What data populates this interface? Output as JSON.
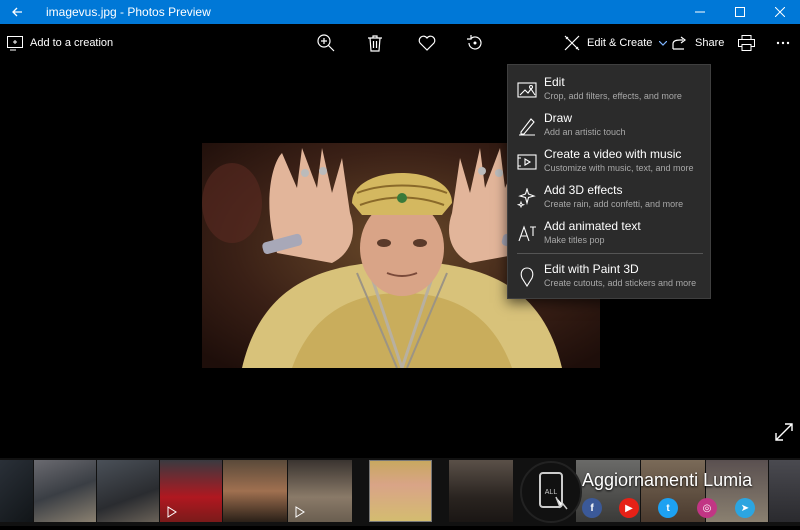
{
  "window": {
    "title": "imagevus.jpg - Photos Preview",
    "controls": [
      "minimize",
      "maximize",
      "close"
    ]
  },
  "toolbar": {
    "add_to_creation": "Add to a creation",
    "edit_create": "Edit & Create",
    "share": "Share",
    "icons": [
      "zoom-icon",
      "delete-icon",
      "favorite-icon",
      "rotate-icon",
      "print-icon",
      "more-icon"
    ]
  },
  "menu": {
    "items": [
      {
        "title": "Edit",
        "subtitle": "Crop, add filters, effects, and more",
        "icon": "edit-photo-icon"
      },
      {
        "title": "Draw",
        "subtitle": "Add an artistic touch",
        "icon": "draw-icon"
      },
      {
        "title": "Create a video with music",
        "subtitle": "Customize with music, text, and more",
        "icon": "video-icon"
      },
      {
        "title": "Add 3D effects",
        "subtitle": "Create rain, add confetti, and more",
        "icon": "sparkle-icon"
      },
      {
        "title": "Add animated text",
        "subtitle": "Make titles pop",
        "icon": "animated-text-icon"
      },
      {
        "title": "Edit with Paint 3D",
        "subtitle": "Create cutouts, add stickers and more",
        "icon": "paint3d-icon"
      }
    ]
  },
  "watermark": {
    "text": "Aggiornamenti Lumia",
    "logo_text": "ALL",
    "social": [
      {
        "name": "facebook",
        "glyph": "f",
        "color": "#3b5998"
      },
      {
        "name": "youtube",
        "glyph": "▶",
        "color": "#e62117"
      },
      {
        "name": "twitter",
        "glyph": "t",
        "color": "#1da1f2"
      },
      {
        "name": "instagram",
        "glyph": "◎",
        "color": "#c13584"
      },
      {
        "name": "telegram",
        "glyph": "➤",
        "color": "#2ca5e0"
      }
    ]
  },
  "colors": {
    "titlebar": "#0078d7",
    "menu_bg": "#2b2b2b",
    "background": "#000000"
  }
}
